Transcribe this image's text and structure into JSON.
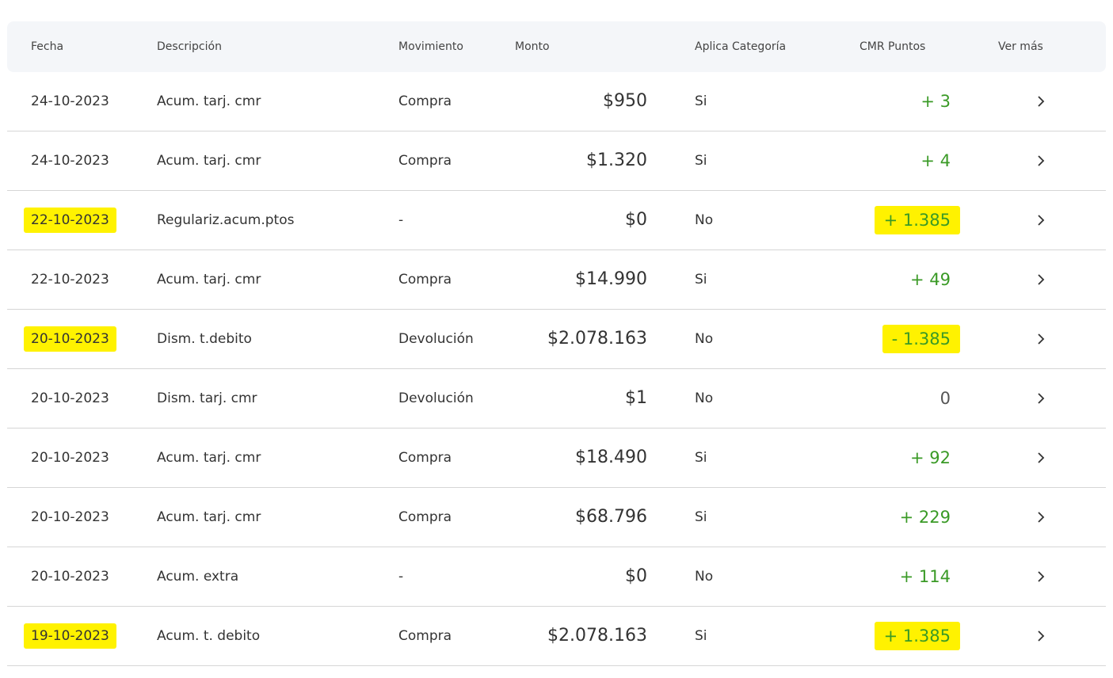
{
  "table": {
    "headers": {
      "fecha": "Fecha",
      "descripcion": "Descripción",
      "movimiento": "Movimiento",
      "monto": "Monto",
      "aplica": "Aplica Categoría",
      "puntos": "CMR Puntos",
      "ver_mas": "Ver más"
    },
    "rows": [
      {
        "fecha": "24-10-2023",
        "descripcion": "Acum. tarj. cmr",
        "movimiento": "Compra",
        "monto": "$950",
        "aplica": "Si",
        "puntos": "+ 3"
      },
      {
        "fecha": "24-10-2023",
        "descripcion": "Acum. tarj. cmr",
        "movimiento": "Compra",
        "monto": "$1.320",
        "aplica": "Si",
        "puntos": "+ 4"
      },
      {
        "fecha": "22-10-2023",
        "descripcion": "Regulariz.acum.ptos",
        "movimiento": "-",
        "monto": "$0",
        "aplica": "No",
        "puntos": "+ 1.385"
      },
      {
        "fecha": "22-10-2023",
        "descripcion": "Acum. tarj. cmr",
        "movimiento": "Compra",
        "monto": "$14.990",
        "aplica": "Si",
        "puntos": "+ 49"
      },
      {
        "fecha": "20-10-2023",
        "descripcion": "Dism. t.debito",
        "movimiento": "Devolución",
        "monto": "$2.078.163",
        "aplica": "No",
        "puntos": "- 1.385"
      },
      {
        "fecha": "20-10-2023",
        "descripcion": "Dism. tarj. cmr",
        "movimiento": "Devolución",
        "monto": "$1",
        "aplica": "No",
        "puntos": "0"
      },
      {
        "fecha": "20-10-2023",
        "descripcion": "Acum. tarj. cmr",
        "movimiento": "Compra",
        "monto": "$18.490",
        "aplica": "Si",
        "puntos": "+ 92"
      },
      {
        "fecha": "20-10-2023",
        "descripcion": "Acum. tarj. cmr",
        "movimiento": "Compra",
        "monto": "$68.796",
        "aplica": "Si",
        "puntos": "+ 229"
      },
      {
        "fecha": "20-10-2023",
        "descripcion": "Acum. extra",
        "movimiento": "-",
        "monto": "$0",
        "aplica": "No",
        "puntos": "+ 114"
      },
      {
        "fecha": "19-10-2023",
        "descripcion": "Acum. t. debito",
        "movimiento": "Compra",
        "monto": "$2.078.163",
        "aplica": "Si",
        "puntos": "+ 1.385"
      }
    ]
  },
  "colors": {
    "points_positive": "#3a9a26",
    "highlight": "#fff200",
    "header_bg": "#f4f6f9"
  },
  "icons": {
    "row_action": "chevron-right-icon"
  }
}
